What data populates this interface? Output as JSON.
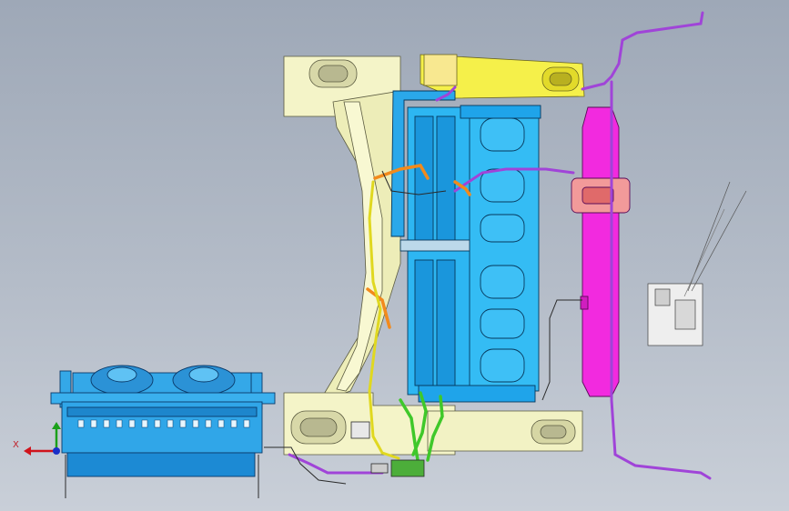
{
  "viewport": {
    "background_top": "#9ea8b7",
    "background_bottom": "#c9cfd8"
  },
  "triad": {
    "x_label": "X",
    "x_color": "#d0141c",
    "y_color": "#1aa01a",
    "z_color": "#1a30c8"
  },
  "colors": {
    "frame_rail": "#f4f4c8",
    "crossmember_yellow": "#f5f04a",
    "cooling_core": "#2db6f2",
    "cooling_core_dark": "#0e7fc8",
    "expansion_tank": "#f22adf",
    "aux_radiator": "#34a8e8",
    "coolant_hose_green": "#3fc82a",
    "hose_purple": "#a044d8",
    "hose_orange": "#f28a1c"
  },
  "components": [
    {
      "name": "chassis-frame",
      "interactive": false
    },
    {
      "name": "main-cooling-module",
      "interactive": false
    },
    {
      "name": "expansion-tank",
      "interactive": false
    },
    {
      "name": "auxiliary-radiator",
      "interactive": false
    },
    {
      "name": "coolant-hoses",
      "interactive": false
    }
  ]
}
